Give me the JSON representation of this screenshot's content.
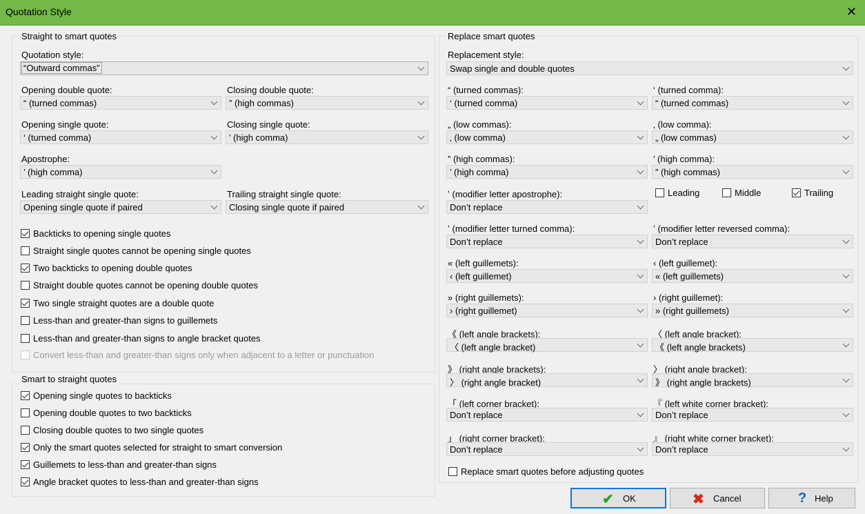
{
  "window": {
    "title": "Quotation Style",
    "close_glyph": "✕"
  },
  "left": {
    "group1_title": "Straight to smart quotes",
    "quotation_style": {
      "label": "Quotation style:",
      "value": "“Outward commas”"
    },
    "opening_double": {
      "label": "Opening double quote:",
      "value": "“ (turned commas)"
    },
    "closing_double": {
      "label": "Closing double quote:",
      "value": "” (high commas)"
    },
    "opening_single": {
      "label": "Opening single quote:",
      "value": "‘ (turned comma)"
    },
    "closing_single": {
      "label": "Closing single quote:",
      "value": "’ (high comma)"
    },
    "apostrophe": {
      "label": "Apostrophe:",
      "value": "’ (high comma)"
    },
    "leading_straight": {
      "label": "Leading straight single quote:",
      "value": "Opening single quote if paired"
    },
    "trailing_straight": {
      "label": "Trailing straight single quote:",
      "value": "Closing single quote if paired"
    },
    "checks1": [
      {
        "label": "Backticks to opening single quotes",
        "checked": true
      },
      {
        "label": "Straight single quotes cannot be opening single quotes",
        "checked": false
      },
      {
        "label": "Two backticks to opening double quotes",
        "checked": true
      },
      {
        "label": "Straight double quotes cannot be opening double quotes",
        "checked": false
      },
      {
        "label": "Two single straight quotes are a double quote",
        "checked": true
      },
      {
        "label": "Less-than and greater-than signs to guillemets",
        "checked": false
      },
      {
        "label": "Less-than and greater-than signs to angle bracket quotes",
        "checked": false
      },
      {
        "label": "Convert less-than and greater-than signs only when adjacent to a letter or punctuation",
        "checked": false,
        "disabled": true
      }
    ],
    "group2_title": "Smart to straight quotes",
    "checks2": [
      {
        "label": "Opening single quotes to backticks",
        "checked": true
      },
      {
        "label": "Opening double quotes to two backticks",
        "checked": false
      },
      {
        "label": "Closing double quotes to two single quotes",
        "checked": false
      },
      {
        "label": "Only the smart quotes selected for straight to smart conversion",
        "checked": true
      },
      {
        "label": "Guillemets to less-than and greater-than signs",
        "checked": true
      },
      {
        "label": "Angle bracket quotes to less-than and greater-than signs",
        "checked": true
      }
    ]
  },
  "right": {
    "group_title": "Replace smart quotes",
    "replacement_style": {
      "label": "Replacement style:",
      "value": "Swap single and double quotes"
    },
    "rows": [
      {
        "l_label": "“ (turned commas):",
        "l_value": "‘ (turned comma)",
        "r_label": "‘ (turned comma):",
        "r_value": "“ (turned commas)"
      },
      {
        "l_label": "„ (low commas):",
        "l_value": "‚ (low comma)",
        "r_label": "‚ (low comma):",
        "r_value": "„ (low commas)"
      },
      {
        "l_label": "” (high commas):",
        "l_value": "’ (high comma)",
        "r_label": "’ (high comma):",
        "r_value": "” (high commas)"
      },
      {
        "l_label": "ʼ (modifier letter apostrophe):",
        "l_value": "Don’t replace"
      },
      {
        "l_label": "ʻ (modifier letter turned comma):",
        "l_value": "Don’t replace",
        "r_label": "ʽ (modifier letter reversed comma):",
        "r_value": "Don’t replace"
      },
      {
        "l_label": "« (left guillemets):",
        "l_value": "‹ (left guillemet)",
        "r_label": "‹ (left guillemet):",
        "r_value": "« (left guillemets)"
      },
      {
        "l_label": "» (right guillemets):",
        "l_value": "› (right guillemet)",
        "r_label": "› (right guillemet):",
        "r_value": "» (right guillemets)"
      },
      {
        "l_label": "《 (left angle brackets):",
        "l_value": "〈 (left angle bracket)",
        "r_label": "〈 (left angle bracket):",
        "r_value": "《 (left angle brackets)"
      },
      {
        "l_label": "》 (right angle brackets):",
        "l_value": "〉 (right angle bracket)",
        "r_label": "〉 (right angle bracket):",
        "r_value": "》 (right angle brackets)"
      },
      {
        "l_label": "「 (left corner bracket):",
        "l_value": "Don’t replace",
        "r_label": "『 (left white corner bracket):",
        "r_value": "Don’t replace"
      },
      {
        "l_label": "」 (right corner bracket):",
        "l_value": "Don’t replace",
        "r_label": "』 (right white corner bracket):",
        "r_value": "Don’t replace"
      }
    ],
    "apostrophe_checks": [
      {
        "label": "Leading",
        "checked": false
      },
      {
        "label": "Middle",
        "checked": false
      },
      {
        "label": "Trailing",
        "checked": true
      }
    ],
    "replace_before": {
      "label": "Replace smart quotes before adjusting quotes",
      "checked": false
    }
  },
  "buttons": {
    "ok": {
      "label": "OK",
      "icon": "check-icon",
      "color": "#2e9e2e"
    },
    "cancel": {
      "label": "Cancel",
      "icon": "x-icon",
      "color": "#d62b1f"
    },
    "help": {
      "label": "Help",
      "icon": "question-icon",
      "color": "#1a5fb4"
    }
  }
}
